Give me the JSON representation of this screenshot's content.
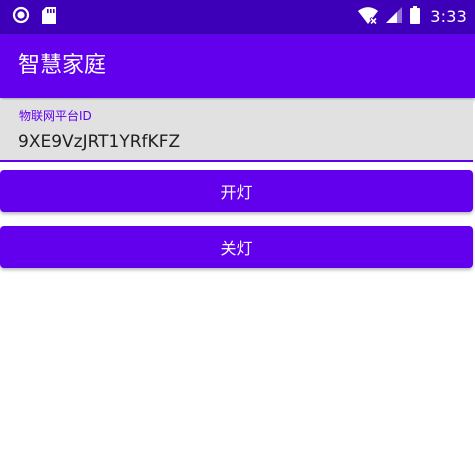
{
  "status_bar": {
    "time": "3:33",
    "icons": {
      "left": [
        "notification-circle-icon",
        "sd-card-icon"
      ],
      "right": [
        "wifi-icon",
        "cell-signal-icon",
        "battery-icon"
      ]
    }
  },
  "app_bar": {
    "title": "智慧家庭"
  },
  "platform_id_field": {
    "label": "物联网平台ID",
    "value": "9XE9VzJRT1YRfKFZ"
  },
  "buttons": {
    "turn_on": "开灯",
    "turn_off": "关灯"
  },
  "colors": {
    "status_bar": "#3d00b8",
    "primary": "#6200ee",
    "field_background": "#e1e1e1",
    "on_primary": "#ffffff"
  }
}
